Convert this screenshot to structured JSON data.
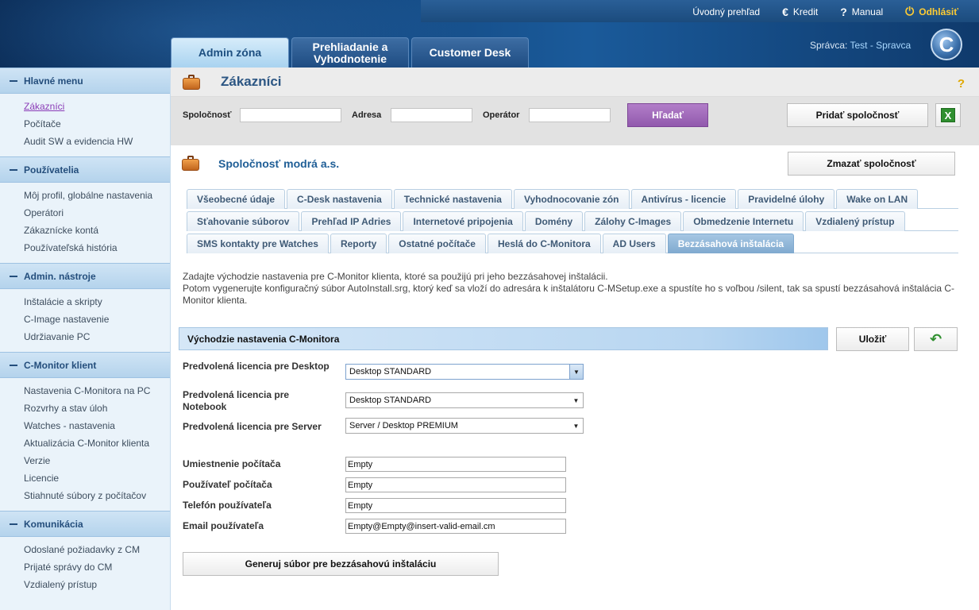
{
  "top_links": {
    "overview": "Úvodný prehľad",
    "credit": "Kredit",
    "credit_icon": "€",
    "manual": "Manual",
    "manual_icon": "?",
    "logout": "Odhlásiť",
    "logout_icon": "⏻"
  },
  "main_tabs": {
    "admin": "Admin zóna",
    "overview": "Prehliadanie a Vyhodnotenie",
    "customer_desk": "Customer Desk"
  },
  "admin_user": {
    "label": "Správca:",
    "name": "Test - Spravca"
  },
  "logo_letter": "C",
  "sidebar": {
    "sections": [
      {
        "title": "Hlavné menu",
        "items": [
          "Zákazníci",
          "Počítače",
          "Audit SW a evidencia HW"
        ]
      },
      {
        "title": "Používatelia",
        "items": [
          "Môj profil, globálne nastavenia",
          "Operátori",
          "Zákaznícke kontá",
          "Používateľská história"
        ]
      },
      {
        "title": "Admin. nástroje",
        "items": [
          "Inštalácie a skripty",
          "C-Image nastavenie",
          "Udržiavanie PC"
        ]
      },
      {
        "title": "C-Monitor klient",
        "items": [
          "Nastavenia C-Monitora na PC",
          "Rozvrhy a stav úloh",
          "Watches - nastavenia",
          "Aktualizácia C-Monitor klienta",
          "Verzie",
          "Licencie",
          "Stiahnuté súbory z počítačov"
        ]
      },
      {
        "title": "Komunikácia",
        "items": [
          "Odoslané požiadavky z CM",
          "Prijaté správy do CM",
          "Vzdialený prístup"
        ]
      }
    ],
    "active_item": "Zákazníci"
  },
  "page": {
    "title": "Zákazníci",
    "help": "?"
  },
  "filters": {
    "company_label": "Spoločnosť",
    "company_value": "",
    "address_label": "Adresa",
    "address_value": "",
    "operator_label": "Operátor",
    "operator_value": "",
    "search_button": "Hľadať",
    "add_company_button": "Pridať spoločnosť",
    "excel_icon": "X"
  },
  "company": {
    "name": "Spoločnosť modrá a.s.",
    "delete_button": "Zmazať spoločnosť"
  },
  "subtabs": {
    "row1": [
      "Všeobecné údaje",
      "C-Desk nastavenia",
      "Technické nastavenia",
      "Vyhodnocovanie zón",
      "Antivírus - licencie",
      "Pravidelné úlohy",
      "Wake on LAN"
    ],
    "row2": [
      "Sťahovanie súborov",
      "Prehľad IP Adries",
      "Internetové pripojenia",
      "Domény",
      "Zálohy C-Images",
      "Obmedzenie Internetu",
      "Vzdialený prístup"
    ],
    "row3": [
      "SMS kontakty pre Watches",
      "Reporty",
      "Ostatné počítače",
      "Heslá do C-Monitora",
      "AD Users",
      "Bezzásahová inštalácia"
    ],
    "active": "Bezzásahová inštalácia"
  },
  "description": {
    "line1": "Zadajte východzie nastavenia pre C-Monitor klienta, ktoré sa použijú pri jeho bezzásahovej inštalácii.",
    "line2": "Potom vygenerujte konfiguračný súbor AutoInstall.srg, ktorý keď sa vloží do adresára k inštalátoru C-MSetup.exe a spustíte ho s voľbou /silent, tak sa spustí bezzásahová inštalácia C-Monitor klienta."
  },
  "section": {
    "title": "Východzie nastavenia C-Monitora",
    "save_button": "Uložiť",
    "back_icon": "↶"
  },
  "licenses": {
    "desktop_label": "Predvolená licencia pre Desktop",
    "desktop_value": "Desktop STANDARD",
    "notebook_label": "Predvolená licencia pre Notebook",
    "notebook_value": "Desktop STANDARD",
    "server_label": "Predvolená licencia pre Server",
    "server_value": "Server / Desktop PREMIUM"
  },
  "fields": {
    "location_label": "Umiestnenie počítača",
    "location_value": "Empty",
    "user_label": "Používateľ počítača",
    "user_value": "Empty",
    "phone_label": "Telefón používateľa",
    "phone_value": "Empty",
    "email_label": "Email používateľa",
    "email_value": "Empty@Empty@insert-valid-email.cm"
  },
  "generate_button": "Generuj súbor pre bezzásahovú inštaláciu",
  "colors": {
    "accent_purple": "#9159ad",
    "header_blue": "#13477f",
    "active_subtab": "#7fa9cf",
    "logout_yellow": "#ffcc33"
  }
}
